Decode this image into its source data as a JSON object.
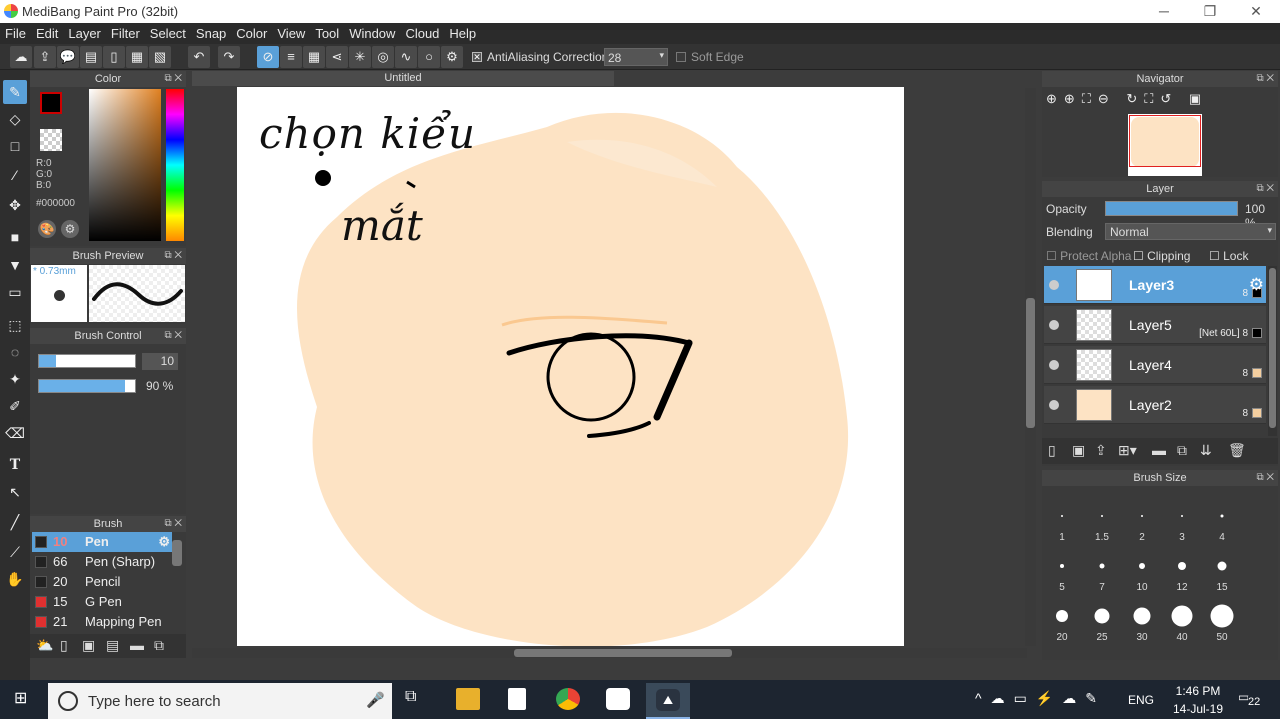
{
  "window": {
    "title": "MediBang Paint Pro (32bit)",
    "min": "─",
    "max": "❐",
    "close": "✕"
  },
  "menu": [
    "File",
    "Edit",
    "Layer",
    "Filter",
    "Select",
    "Snap",
    "Color",
    "View",
    "Tool",
    "Window",
    "Cloud",
    "Help"
  ],
  "toolbar": {
    "antialiasing_label": "AntiAliasing",
    "correction_label": "Correction",
    "correction_value": "28",
    "soft_edge_label": "Soft Edge"
  },
  "color_panel": {
    "title": "Color",
    "r": "R:0",
    "g": "G:0",
    "b": "B:0",
    "hex": "#000000",
    "fg": "#000000",
    "bg": "#ffffff"
  },
  "brush_preview": {
    "title": "Brush Preview",
    "size": "* 0.73mm"
  },
  "brush_control": {
    "title": "Brush Control",
    "size_value": "10",
    "opacity_value": "90 %"
  },
  "brush_panel": {
    "title": "Brush",
    "items": [
      {
        "num": "10",
        "name": "Pen",
        "color": "#222222"
      },
      {
        "num": "66",
        "name": "Pen (Sharp)",
        "color": "#222222"
      },
      {
        "num": "20",
        "name": "Pencil",
        "color": "#222222"
      },
      {
        "num": "15",
        "name": "G Pen",
        "color": "#e03030"
      },
      {
        "num": "21",
        "name": "Mapping Pen",
        "color": "#e03030"
      }
    ]
  },
  "canvas": {
    "tab": "Untitled",
    "handwriting_line1": "chọn kiểu",
    "handwriting_line2": "mắt"
  },
  "navigator": {
    "title": "Navigator"
  },
  "layer_panel": {
    "title": "Layer",
    "opacity_label": "Opacity",
    "opacity_value": "100 %",
    "opacity_percent": 100,
    "blending_label": "Blending",
    "blending_value": "Normal",
    "protect_alpha": "Protect Alpha",
    "clipping": "Clipping",
    "lock": "Lock",
    "layers": [
      {
        "name": "Layer3",
        "meta": "8",
        "swatch": "#000000"
      },
      {
        "name": "Layer5",
        "meta": "[Net 60L] 8",
        "swatch": "#000000"
      },
      {
        "name": "Layer4",
        "meta": "8",
        "swatch": "#f5cfa0"
      },
      {
        "name": "Layer2",
        "meta": "8",
        "swatch": "#f5cfa0"
      }
    ]
  },
  "brush_size": {
    "title": "Brush Size",
    "sizes": [
      "1",
      "1.5",
      "2",
      "3",
      "4",
      "5",
      "7",
      "10",
      "12",
      "15",
      "20",
      "25",
      "30",
      "40",
      "50"
    ]
  },
  "taskbar": {
    "search_placeholder": "Type here to search",
    "lang": "ENG",
    "time": "1:46 PM",
    "date": "14-Jul-19",
    "notifications": "22"
  },
  "colors": {
    "accent": "#5aa0d8",
    "skin": "#fde3c4"
  }
}
